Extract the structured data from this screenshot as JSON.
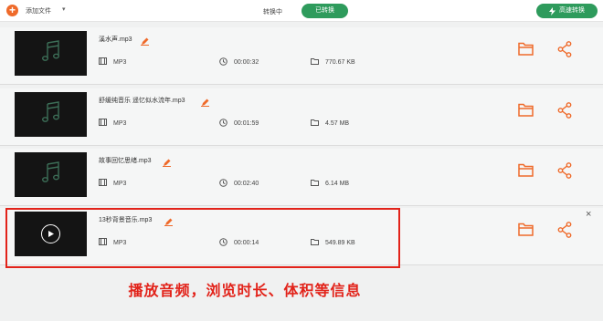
{
  "toolbar": {
    "add_label": "添加文件",
    "add_symbol": "+",
    "caret": "▾",
    "tab_converting": "转换中",
    "tab_converted": "已转换",
    "fast_convert": "高速转换"
  },
  "files": [
    {
      "name": "溪水声.mp3",
      "format": "MP3",
      "duration": "00:00:32",
      "size": "770.67 KB"
    },
    {
      "name": "舒缓纯音乐 遥忆似水流年.mp3",
      "format": "MP3",
      "duration": "00:01:59",
      "size": "4.57 MB"
    },
    {
      "name": "故事回忆思绪.mp3",
      "format": "MP3",
      "duration": "00:02:40",
      "size": "6.14 MB"
    },
    {
      "name": "13秒背景音乐.mp3",
      "format": "MP3",
      "duration": "00:00:14",
      "size": "549.89 KB"
    }
  ],
  "close_symbol": "×",
  "caption": "播放音频，浏览时长、体积等信息",
  "colors": {
    "accent_orange": "#ef6a2a",
    "green": "#2e9b5c",
    "annotation_red": "#e2231a"
  },
  "icons": [
    "add-icon",
    "music-note-icon",
    "play-icon",
    "edit-icon",
    "format-icon",
    "clock-icon",
    "folder-size-icon",
    "open-folder-icon",
    "share-icon",
    "lightning-icon",
    "close-icon"
  ]
}
